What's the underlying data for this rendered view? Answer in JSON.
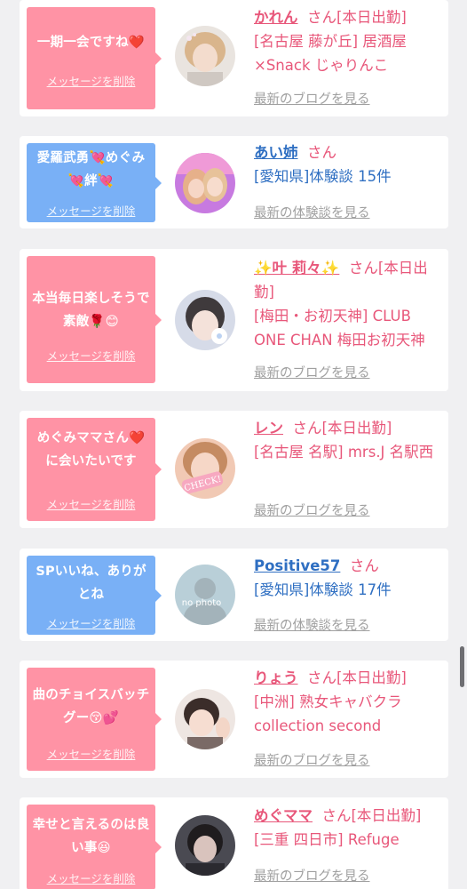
{
  "messages": [
    {
      "type": "pink",
      "text": "一期一会ですね❤️",
      "delete_label": "メッセージを削除",
      "name": "かれん",
      "suffix": "さん[本日出勤]",
      "shop": "[名古屋 藤が丘] 居酒屋×Snack じゃりんこ",
      "link": "最新のブログを見る"
    },
    {
      "type": "blue",
      "text": "愛羅武勇💘めぐみ💘絆💘",
      "delete_label": "メッセージを削除",
      "name": "あい姉",
      "suffix": "さん",
      "shop": "[愛知県]体験談 15件",
      "link": "最新の体験談を見る"
    },
    {
      "type": "pink",
      "text": "本当毎日楽しそうで素敵🌹😊",
      "delete_label": "メッセージを削除",
      "name": "✨叶 莉々✨",
      "suffix": "さん[本日出勤]",
      "shop": "[梅田・お初天神] CLUB ONE CHAN 梅田お初天神",
      "link": "最新のブログを見る"
    },
    {
      "type": "pink",
      "text": "めぐみママさん❤️に会いたいです",
      "delete_label": "メッセージを削除",
      "name": "レン",
      "suffix": "さん[本日出勤]",
      "shop": "[名古屋 名駅] mrs.J 名駅西",
      "link": "最新のブログを見る",
      "avatar_text": "CHECK!"
    },
    {
      "type": "blue",
      "text": "SPいいね、ありがとね",
      "delete_label": "メッセージを削除",
      "name": "Positive57",
      "suffix": "さん",
      "shop": "[愛知県]体験談 17件",
      "link": "最新の体験談を見る",
      "avatar_text": "no photo"
    },
    {
      "type": "pink",
      "text": "曲のチョイスバッチグー😚💕",
      "delete_label": "メッセージを削除",
      "name": "りょう",
      "suffix": "さん[本日出勤]",
      "shop": "[中洲] 熟女キャバクラcollection second",
      "link": "最新のブログを見る"
    },
    {
      "type": "pink",
      "text": "幸せと言えるのは良い事😆",
      "delete_label": "メッセージを削除",
      "name": "めぐママ",
      "suffix": "さん[本日出勤]",
      "shop": "[三重 四日市] Refuge",
      "link": "最新のブログを見る"
    }
  ],
  "colors": {
    "pink_bubble": "#ff93a5",
    "blue_bubble": "#79b0f6",
    "pink_text": "#e8577a",
    "blue_text": "#2f6fc2",
    "link_gray": "#a0a0a0",
    "background": "#f0f0f2"
  }
}
